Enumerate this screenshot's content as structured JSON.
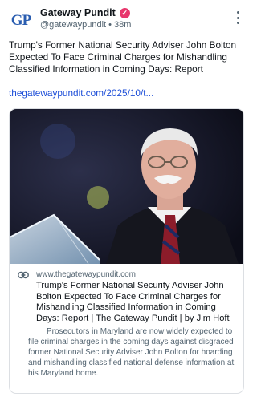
{
  "author": {
    "avatar_text": "GP",
    "name": "Gateway Pundit",
    "handle": "@gatewaypundit",
    "separator": "•",
    "time": "38m"
  },
  "post": {
    "text": "Trump's Former National Security Adviser John Bolton Expected To Face Criminal Charges for Mishandling Classified Information in Coming Days: Report",
    "link": "thegatewaypundit.com/2025/10/t..."
  },
  "card": {
    "domain": "www.thegatewaypundit.com",
    "title": "Trump's Former National Security Adviser John Bolton Expected To Face Criminal Charges for Mishandling Classified Information in Coming Days: Report | The Gateway Pundit | by Jim Hoft",
    "description": "Prosecutors in Maryland are now widely expected to file criminal charges in the coming days against disgraced former National Security Adviser John Bolton for hoarding and mishandling classified national defense information at his Maryland home."
  },
  "colors": {
    "link": "#1d4ed8",
    "verified_badge": "#e8386d",
    "logo": "#2a5db0"
  },
  "icons": [
    "gp-logo",
    "verified-icon",
    "more-options-icon",
    "link-icon"
  ]
}
